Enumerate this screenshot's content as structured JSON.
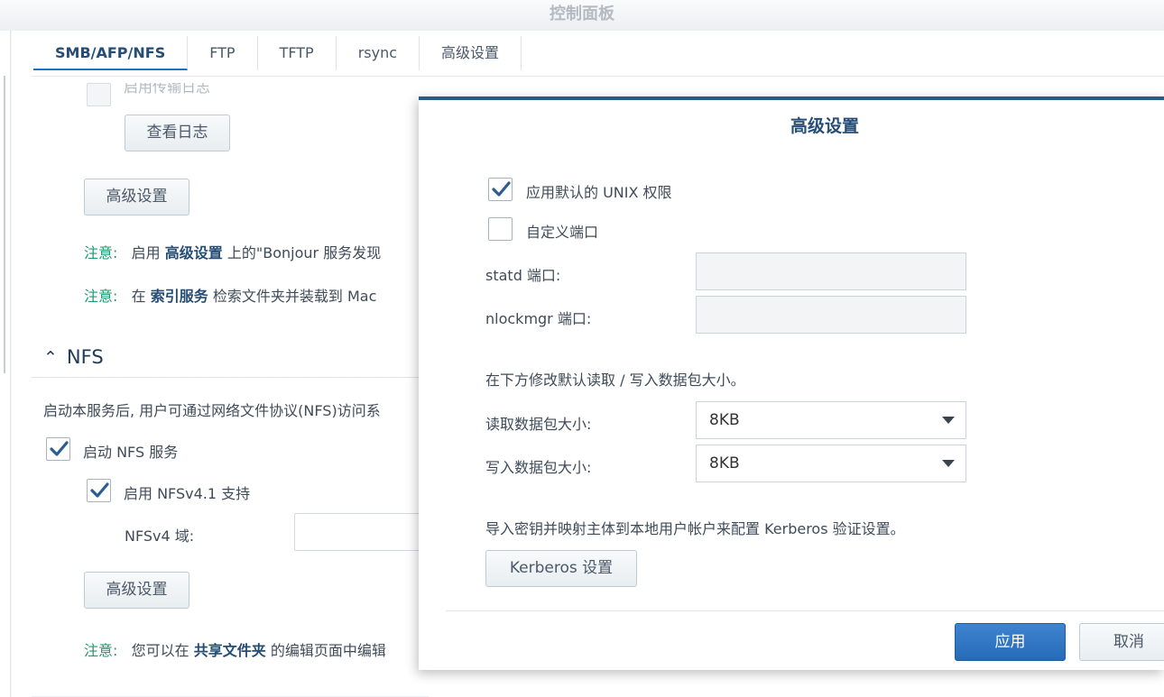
{
  "window": {
    "title": "控制面板"
  },
  "tabs": [
    {
      "label": "SMB/AFP/NFS"
    },
    {
      "label": "FTP"
    },
    {
      "label": "TFTP"
    },
    {
      "label": "rsync"
    },
    {
      "label": "高级设置"
    }
  ],
  "afp": {
    "transfer_log_label": "启用传输日志",
    "view_log_button": "查看日志",
    "advanced_button": "高级设置",
    "note1": {
      "label": "注意:",
      "pre": "启用",
      "link": "高级设置",
      "post": "上的\"Bonjour 服务发现"
    },
    "note2": {
      "label": "注意:",
      "pre": "在",
      "link": "索引服务",
      "post": "检索文件夹并装载到 Mac"
    }
  },
  "nfs": {
    "section_title": "NFS",
    "description": "启动本服务后, 用户可通过网络文件协议(NFS)访问系",
    "enable_label": "启动 NFS 服务",
    "enable_checked": true,
    "v41_label": "启用 NFSv4.1 支持",
    "v41_checked": true,
    "domain_label": "NFSv4 域:",
    "domain_value": "",
    "advanced_button": "高级设置",
    "note": {
      "label": "注意:",
      "pre": "您可以在",
      "link": "共享文件夹",
      "post": "的编辑页面中编辑"
    }
  },
  "dialog": {
    "title": "高级设置",
    "unix_perm_label": "应用默认的 UNIX 权限",
    "unix_perm_checked": true,
    "custom_port_label": "自定义端口",
    "custom_port_checked": false,
    "statd_label": "statd 端口:",
    "statd_value": "",
    "nlockmgr_label": "nlockmgr 端口:",
    "nlockmgr_value": "",
    "packet_hint": "在下方修改默认读取 / 写入数据包大小。",
    "read_label": "读取数据包大小:",
    "read_value": "8KB",
    "write_label": "写入数据包大小:",
    "write_value": "8KB",
    "kerberos_hint": "导入密钥并映射主体到本地用户帐户来配置 Kerberos 验证设置。",
    "kerberos_button": "Kerberos 设置",
    "apply_button": "应用",
    "cancel_button": "取消"
  },
  "colors": {
    "accent": "#256bb8",
    "note": "#1e9a6e",
    "heading": "#264d75"
  }
}
